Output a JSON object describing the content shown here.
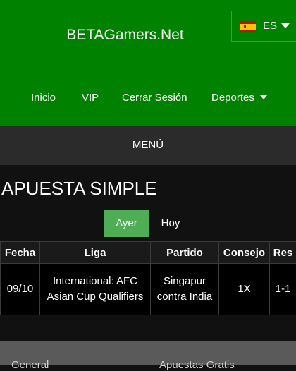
{
  "header": {
    "brand": "BETAGamers.Net",
    "language": {
      "code": "ES",
      "flag": "spain-flag-icon"
    },
    "nav": [
      {
        "label": "Inicio"
      },
      {
        "label": "VIP"
      },
      {
        "label": "Cerrar Sesión"
      },
      {
        "label": "Deportes"
      }
    ]
  },
  "menu": {
    "label": "MENÚ"
  },
  "main": {
    "title": "APUESTA SIMPLE",
    "day_tabs": [
      {
        "label": "Ayer",
        "active": true
      },
      {
        "label": "Hoy",
        "active": false
      }
    ],
    "table": {
      "headers": [
        "Fecha",
        "Liga",
        "Partido",
        "Consejo",
        "Res"
      ],
      "rows": [
        [
          "09/10",
          "International: AFC Asian Cup Qualifiers",
          "Singapur contra India",
          "1X",
          "1-1"
        ]
      ]
    }
  },
  "footer": {
    "col1": "General",
    "col2": "Apuestas Gratis"
  },
  "colors": {
    "header_bg": "#008200",
    "active_tab": "#4fae55",
    "menu_bar": "#2b2b2b",
    "page_bg": "#111111"
  }
}
